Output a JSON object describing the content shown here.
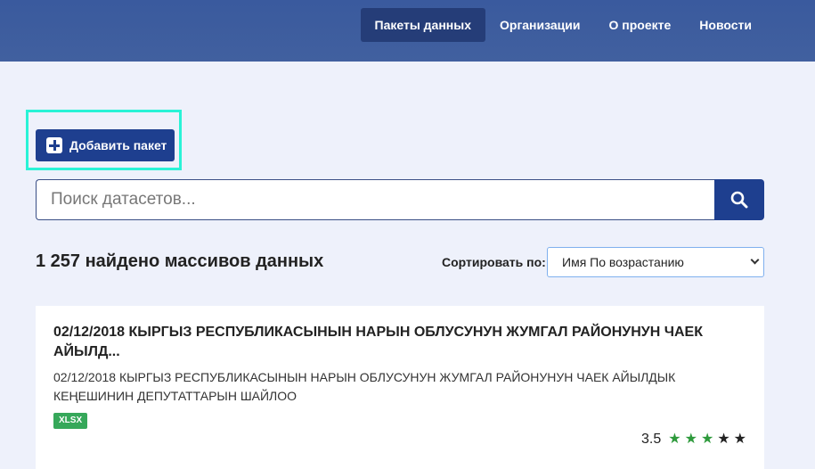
{
  "nav": {
    "items": [
      {
        "label": "Пакеты данных",
        "active": true
      },
      {
        "label": "Организации",
        "active": false
      },
      {
        "label": "О проекте",
        "active": false
      },
      {
        "label": "Новости",
        "active": false
      }
    ]
  },
  "actions": {
    "add_package_label": "Добавить пакет",
    "add_icon": "plus-square-icon"
  },
  "search": {
    "placeholder": "Поиск датасетов...",
    "value": "",
    "button_icon": "search-icon"
  },
  "results": {
    "count_text": "1 257 найдено массивов данных"
  },
  "sort": {
    "label": "Сортировать по:",
    "selected": "Имя По возрастанию"
  },
  "datasets": [
    {
      "title": "02/12/2018 КЫРГЫЗ РЕСПУБЛИКАСЫНЫН НАРЫН ОБЛУСУНУН ЖУМГАЛ РАЙОНУНУН ЧАЕК АЙЫЛД...",
      "description": "02/12/2018 КЫРГЫЗ РЕСПУБЛИКАСЫНЫН НАРЫН ОБЛУСУНУН ЖУМГАЛ РАЙОНУНУН ЧАЕК АЙЫЛДЫК КЕҢЕШИНИН ДЕПУТАТТАРЫН ШАЙЛОО",
      "format": "XLSX",
      "rating": "3.5",
      "stars_filled": 3,
      "stars_total": 5
    }
  ],
  "colors": {
    "header": "#41609f",
    "primary": "#1e3f8f",
    "badge": "#36a85a",
    "star_on": "#2e9a3c",
    "highlight": "#29f3d6"
  }
}
